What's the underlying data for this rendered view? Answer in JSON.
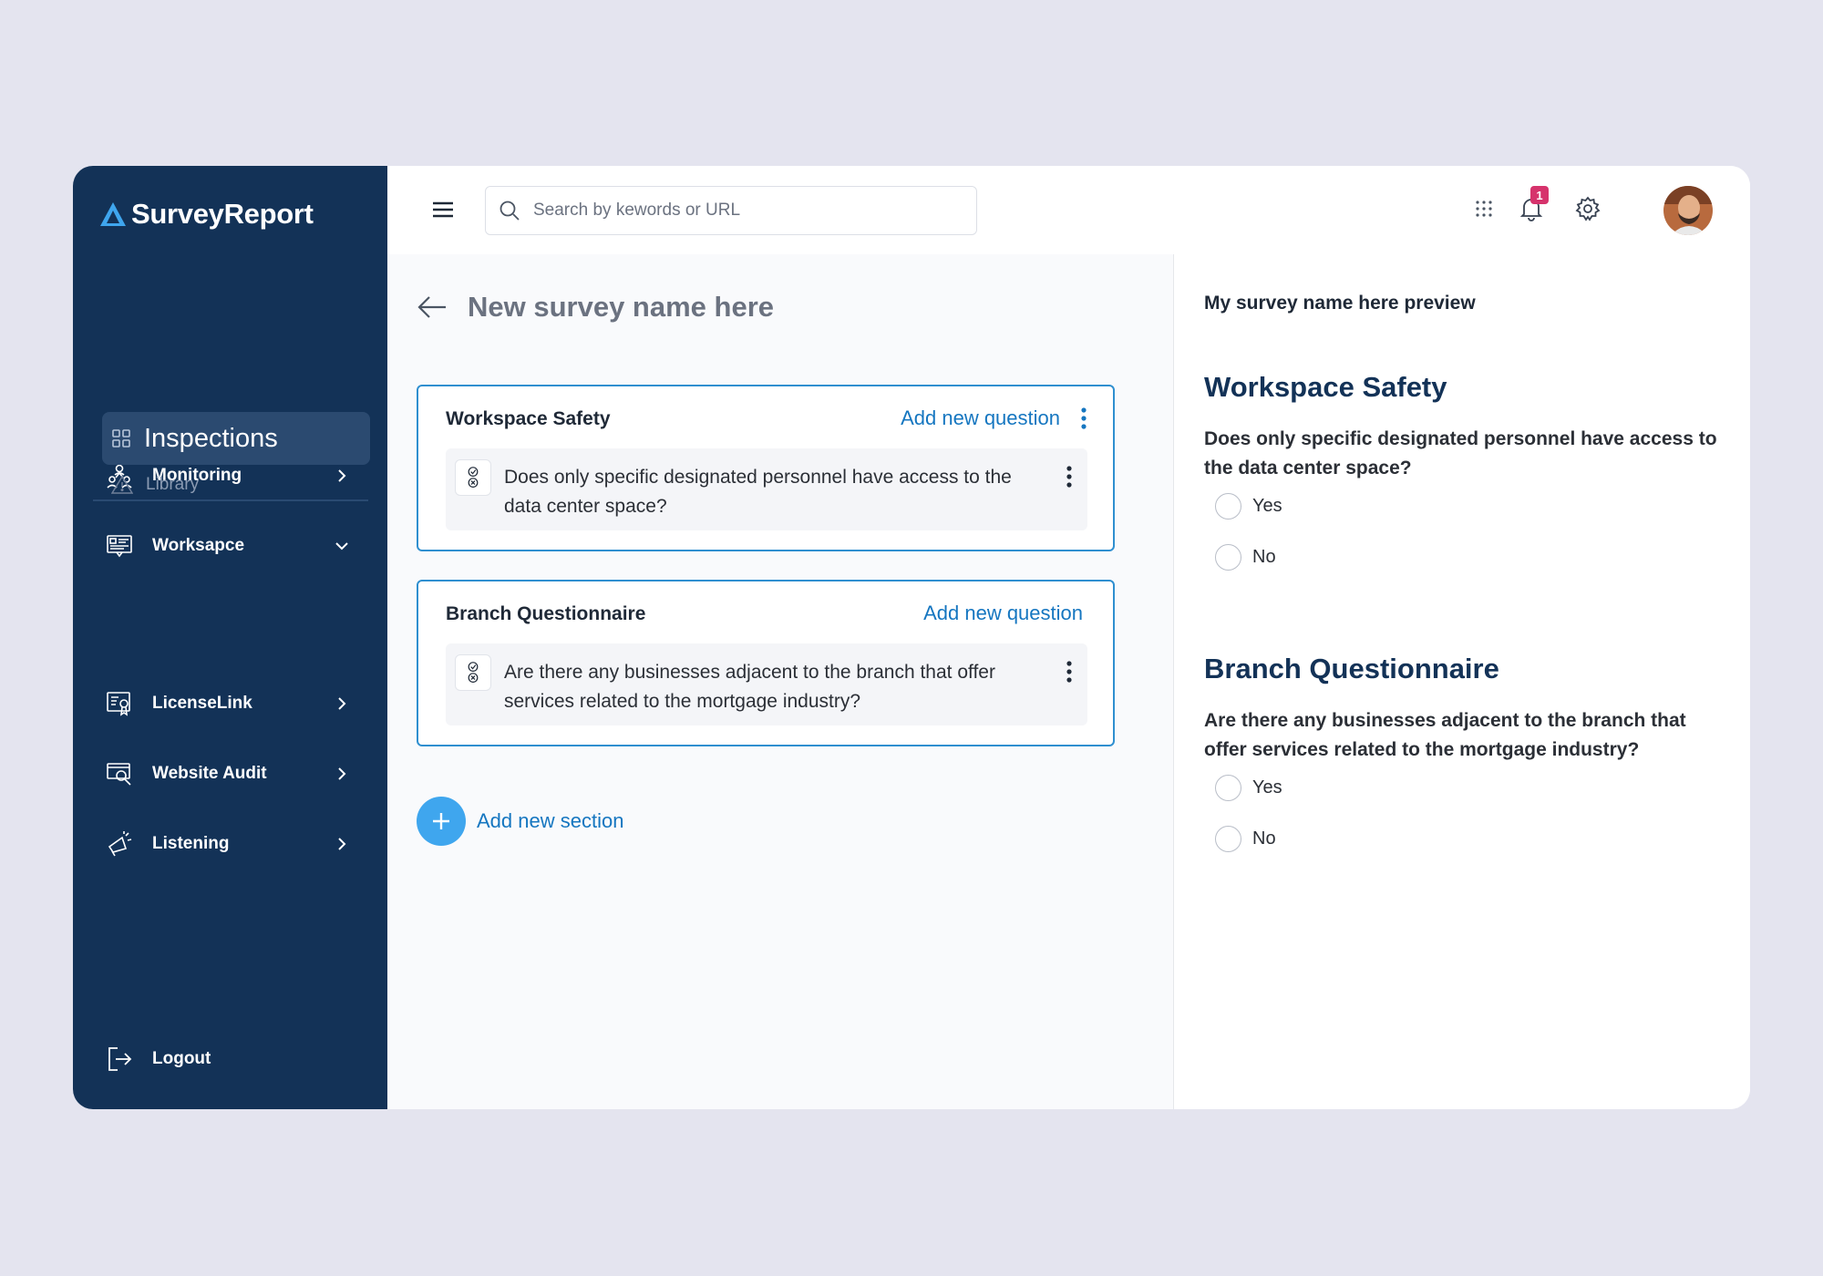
{
  "app": {
    "brand": "SurveyReport",
    "colors": {
      "sidebar": "#133257",
      "accent": "#1576c0",
      "card_border": "#2f8fd0",
      "fab": "#3fa6ee",
      "badge": "#d6336c"
    }
  },
  "sidebar": {
    "items": [
      {
        "label": "Monitoring",
        "icon": "people-network-icon"
      },
      {
        "label": "Worksapce",
        "icon": "workspace-board-icon"
      },
      {
        "label": "LicenseLink",
        "icon": "license-certificate-icon"
      },
      {
        "label": "Website Audit",
        "icon": "website-audit-icon"
      },
      {
        "label": "Listening",
        "icon": "megaphone-icon"
      }
    ],
    "sub_items": [
      {
        "label": "Inspections",
        "icon": "grid-icon",
        "active": true
      },
      {
        "label": "Library",
        "icon": "warning-triangle-icon"
      }
    ],
    "logout_label": "Logout"
  },
  "topbar": {
    "search_placeholder": "Search by kewords or URL",
    "notification_count": "1"
  },
  "editor": {
    "survey_name": "New survey name here",
    "add_question_label": "Add new question",
    "add_section_label": "Add new section",
    "sections": [
      {
        "title": "Workspace Safety",
        "questions": [
          "Does only specific designated personnel have access to the data center space?"
        ]
      },
      {
        "title": "Branch Questionnaire",
        "questions": [
          "Are there any businesses adjacent to the branch that offer services related to the mortgage industry?"
        ]
      }
    ]
  },
  "preview": {
    "title": "My survey name here preview",
    "sections": [
      {
        "title": "Workspace Safety",
        "question": "Does only specific designated personnel have access to the data center space?",
        "options": [
          "Yes",
          "No"
        ]
      },
      {
        "title": "Branch Questionnaire",
        "question": "Are there any businesses adjacent to the branch that offer services related to the mortgage industry?",
        "options": [
          "Yes",
          "No"
        ]
      }
    ]
  }
}
